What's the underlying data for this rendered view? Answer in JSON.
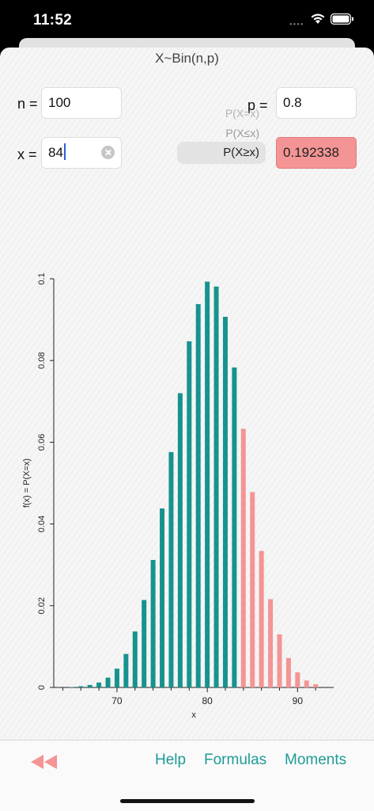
{
  "status": {
    "time": "11:52"
  },
  "title": "X~Bin(n,p)",
  "inputs": {
    "n_label": "n =",
    "n_value": "100",
    "x_label": "x =",
    "x_value": "84",
    "p_label": "p =",
    "p_value": "0.8"
  },
  "picker": {
    "options": [
      "P(X=x)",
      "P(X≤x)",
      "P(X≥x)"
    ],
    "selected": "P(X≥x)"
  },
  "result": "0.192338",
  "colors": {
    "accent": "#1e9c97",
    "bar_primary": "#17938e",
    "bar_highlight": "#f49494"
  },
  "chart_data": {
    "type": "bar",
    "xlabel": "x",
    "ylabel": "f(x) = P(X=x)",
    "xlim": [
      63,
      94
    ],
    "ylim": [
      0,
      0.1
    ],
    "x_ticks": [
      70,
      80,
      90
    ],
    "y_ticks": [
      0,
      0.02,
      0.04,
      0.06,
      0.08,
      0.1
    ],
    "y_tick_labels": [
      "0",
      "0.02",
      "0.04",
      "0.06",
      "0.08",
      "0.1"
    ],
    "highlight_from": 84,
    "x": [
      65,
      66,
      67,
      68,
      69,
      70,
      71,
      72,
      73,
      74,
      75,
      76,
      77,
      78,
      79,
      80,
      81,
      82,
      83,
      84,
      85,
      86,
      87,
      88,
      89,
      90,
      91,
      92
    ],
    "values": [
      0.0001,
      0.0003,
      0.0006,
      0.0012,
      0.0024,
      0.0046,
      0.0082,
      0.0137,
      0.0214,
      0.0312,
      0.0438,
      0.0576,
      0.072,
      0.0847,
      0.0938,
      0.0993,
      0.0981,
      0.0907,
      0.0783,
      0.0633,
      0.0478,
      0.0334,
      0.0216,
      0.013,
      0.0072,
      0.0037,
      0.0017,
      0.0008
    ]
  },
  "toolbar": {
    "rewind_icon": "rewind-icon",
    "help": "Help",
    "formulas": "Formulas",
    "moments": "Moments"
  }
}
